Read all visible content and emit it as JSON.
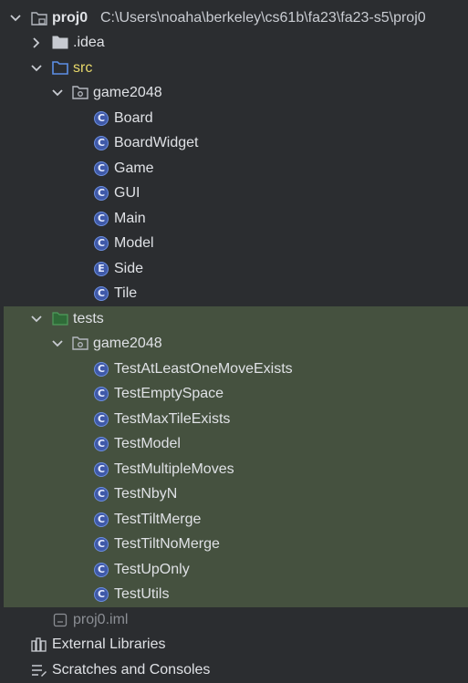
{
  "project": {
    "name": "proj0",
    "path": "C:\\Users\\noaha\\berkeley\\cs61b\\fa23\\fa23-s5\\proj0"
  },
  "idea": {
    "label": ".idea"
  },
  "src": {
    "label": "src",
    "package": "game2048",
    "classes": [
      {
        "label": "Board",
        "kind": "C"
      },
      {
        "label": "BoardWidget",
        "kind": "C"
      },
      {
        "label": "Game",
        "kind": "C"
      },
      {
        "label": "GUI",
        "kind": "C"
      },
      {
        "label": "Main",
        "kind": "C"
      },
      {
        "label": "Model",
        "kind": "C"
      },
      {
        "label": "Side",
        "kind": "E"
      },
      {
        "label": "Tile",
        "kind": "C"
      }
    ]
  },
  "tests": {
    "label": "tests",
    "package": "game2048",
    "classes": [
      {
        "label": "TestAtLeastOneMoveExists",
        "kind": "C"
      },
      {
        "label": "TestEmptySpace",
        "kind": "C"
      },
      {
        "label": "TestMaxTileExists",
        "kind": "C"
      },
      {
        "label": "TestModel",
        "kind": "C"
      },
      {
        "label": "TestMultipleMoves",
        "kind": "C"
      },
      {
        "label": "TestNbyN",
        "kind": "C"
      },
      {
        "label": "TestTiltMerge",
        "kind": "C"
      },
      {
        "label": "TestTiltNoMerge",
        "kind": "C"
      },
      {
        "label": "TestUpOnly",
        "kind": "C"
      },
      {
        "label": "TestUtils",
        "kind": "C"
      }
    ]
  },
  "iml_file": {
    "label": "proj0.iml"
  },
  "external_libraries": {
    "label": "External Libraries"
  },
  "scratches": {
    "label": "Scratches and Consoles"
  },
  "colors": {
    "background": "#2b2d30",
    "tests_highlight": "#45513f",
    "src_label": "#e8d86a",
    "class_icon": "#3f59a8",
    "default_text": "#dfe1e5",
    "excluded_text": "#8b8e94"
  }
}
